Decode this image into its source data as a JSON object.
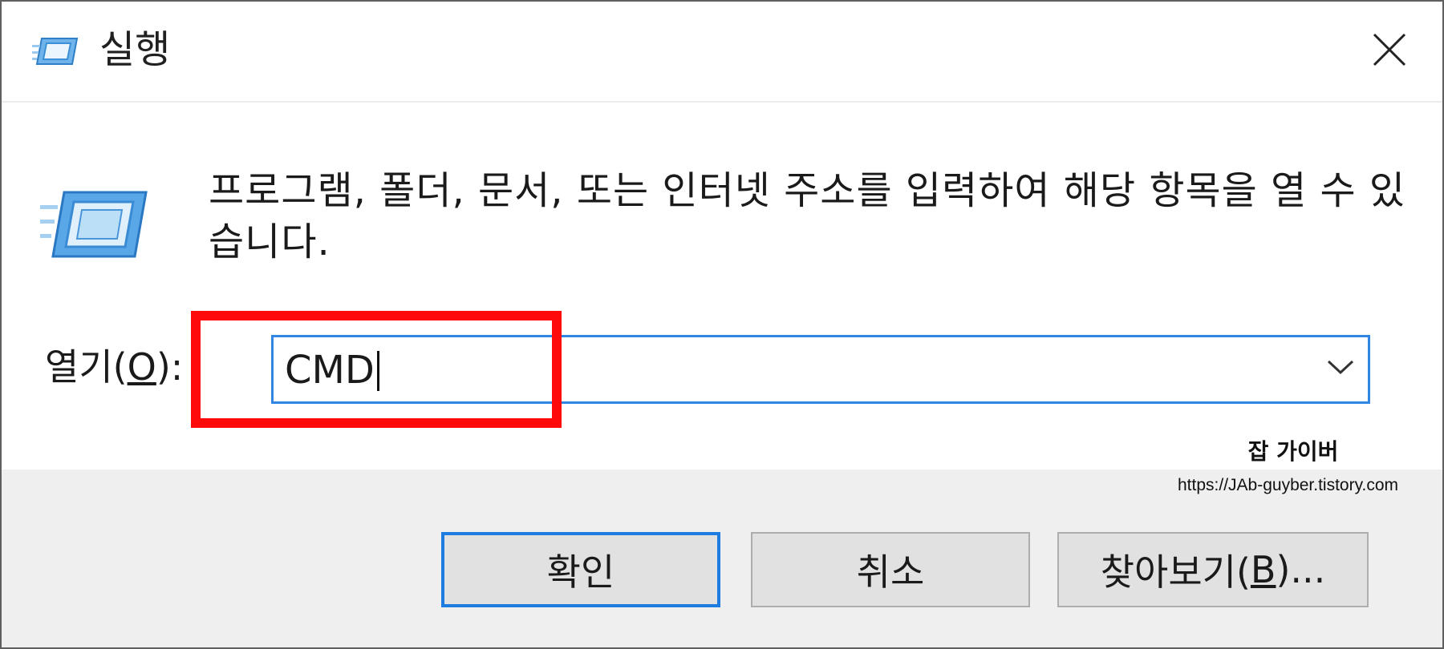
{
  "window": {
    "title": "실행",
    "title_icon": "run-icon",
    "close_icon": "close-icon"
  },
  "description": "프로그램, 폴더, 문서, 또는 인터넷 주소를 입력하여 해당 항목을 열 수 있습니다.",
  "open_field": {
    "label_prefix": "열기(",
    "label_mnemonic": "O",
    "label_suffix": "):",
    "value": "CMD",
    "dropdown_icon": "chevron-down-icon"
  },
  "watermark": {
    "name": "잡 가이버",
    "url": "https://JAb-guyber.tistory.com"
  },
  "buttons": {
    "ok_label": "확인",
    "cancel_label": "취소",
    "browse_prefix": "찾아보기(",
    "browse_mnemonic": "B",
    "browse_suffix": ")..."
  },
  "colors": {
    "accent": "#1e7be0",
    "highlight": "#ff0a0a",
    "footer_bg": "#efefef"
  }
}
